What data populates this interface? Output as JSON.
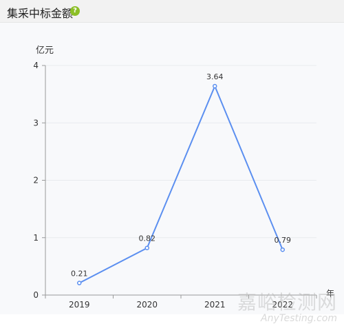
{
  "header": {
    "title": "集采中标金额",
    "help_icon": "question-circle-icon"
  },
  "colors": {
    "line": "#5b8ff0",
    "help_icon": "#8cbf26"
  },
  "watermark": {
    "cn": "嘉峪检测网",
    "en": "AnyTesting.com"
  },
  "chart_data": {
    "type": "line",
    "categories": [
      "2019",
      "2020",
      "2021",
      "2022"
    ],
    "values": [
      0.21,
      0.82,
      3.64,
      0.79
    ],
    "data_labels": [
      "0.21",
      "0.82",
      "3.64",
      "0.79"
    ],
    "y_ticks": [
      "0",
      "1",
      "2",
      "3",
      "4"
    ],
    "ylabel": "亿元",
    "xlabel": "年",
    "ylim": [
      0,
      4
    ],
    "grid": true
  }
}
